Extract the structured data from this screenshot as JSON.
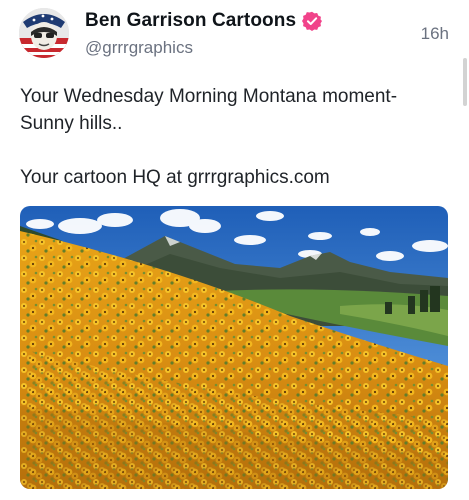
{
  "post": {
    "author_name": "Ben Garrison Cartoons",
    "handle": "@grrrgraphics",
    "timestamp": "16h",
    "text_line1": "Your Wednesday Morning Montana moment-\nSunny hills..",
    "text_line2": "Your cartoon HQ at grrrgraphics.com",
    "verified_color": "#f1438a",
    "media": {
      "subject": "Field of yellow wildflowers on a hillside with mountains and blue sky"
    }
  },
  "icons": {
    "verified": "verified-badge-icon",
    "avatar": "avatar"
  }
}
